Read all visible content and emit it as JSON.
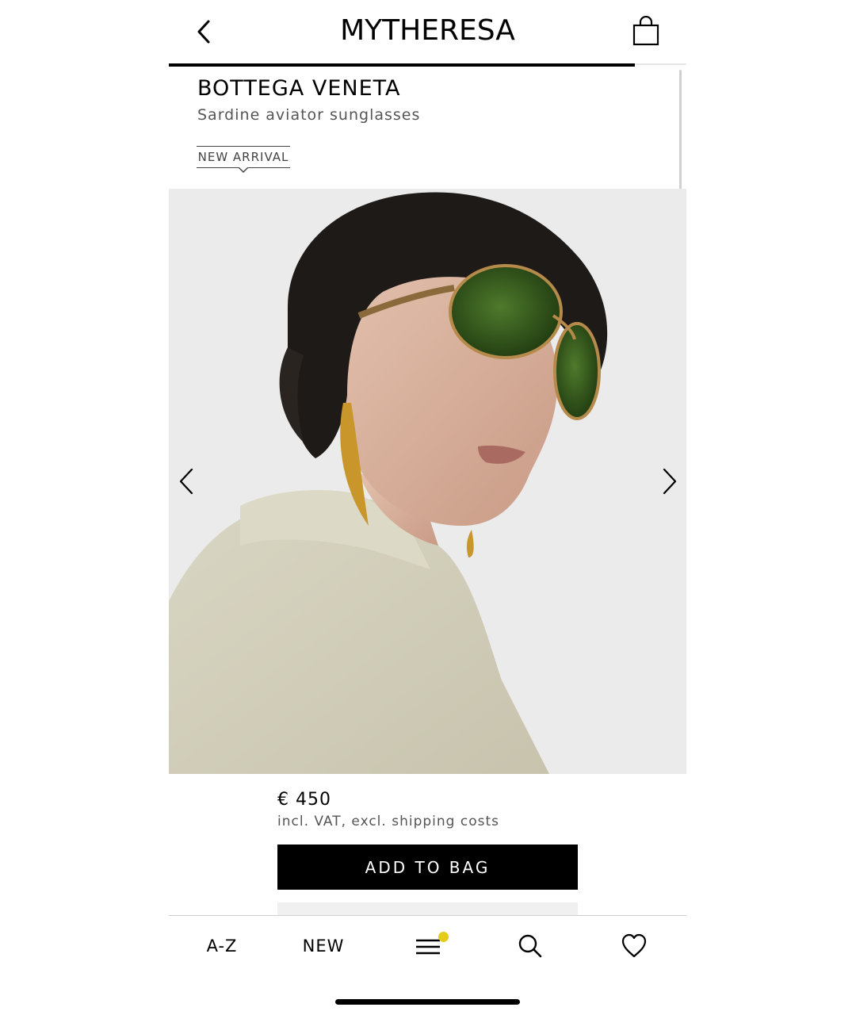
{
  "header": {
    "logo": "MYTHERESA",
    "gallery_progress": 0.9
  },
  "product": {
    "brand": "BOTTEGA VENETA",
    "name": "Sardine aviator sunglasses",
    "badge": "NEW ARRIVAL",
    "price": "€ 450",
    "price_note": "incl. VAT, excl. shipping costs",
    "add_to_bag_label": "ADD TO BAG"
  },
  "icons": {
    "back": "chevron-left-icon",
    "bag": "shopping-bag-icon",
    "prev": "chevron-left-icon",
    "next": "chevron-right-icon",
    "menu": "hamburger-menu-icon",
    "search": "search-icon",
    "wishlist": "heart-icon"
  },
  "bottom_nav": {
    "az_label": "A-Z",
    "new_label": "NEW"
  },
  "colors": {
    "accent": "#000000",
    "notification_dot": "#e5cc1a"
  }
}
